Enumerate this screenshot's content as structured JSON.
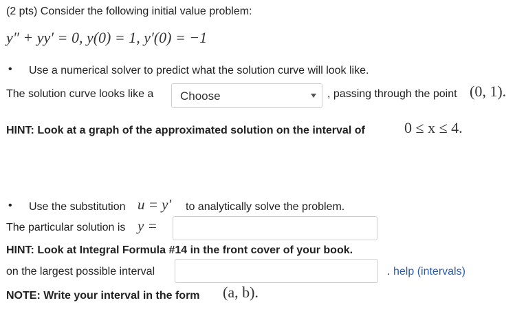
{
  "title": "(2 pts) Consider the following initial value problem:",
  "equation": "y″ + yy′ = 0, y(0) = 1, y′(0) = −1",
  "part1": {
    "bullet": "•",
    "instruction": "Use a numerical solver to predict what the solution curve will look like.",
    "sentence_before": "The solution curve looks like a",
    "select_value": "Choose",
    "sentence_after": ", passing through the point",
    "point": "(0, 1).",
    "hint_text": "HINT: Look at a graph of the approximated solution on the interval of",
    "hint_interval": "0 ≤ x ≤ 4."
  },
  "part2": {
    "bullet": "•",
    "instruction_before": "Use the substitution",
    "substitution": "u = y′",
    "instruction_after": "to analytically solve the problem.",
    "particular_label": "The particular solution is",
    "particular_math": "y =",
    "particular_value": "",
    "hint": "HINT: Look at Integral Formula #14 in the front cover of your book.",
    "interval_label": "on the largest possible interval",
    "interval_value": "",
    "help_dot": ".",
    "help_link": "help (intervals)",
    "note_text": "NOTE: Write your interval in the form",
    "note_math": "(a, b)."
  }
}
